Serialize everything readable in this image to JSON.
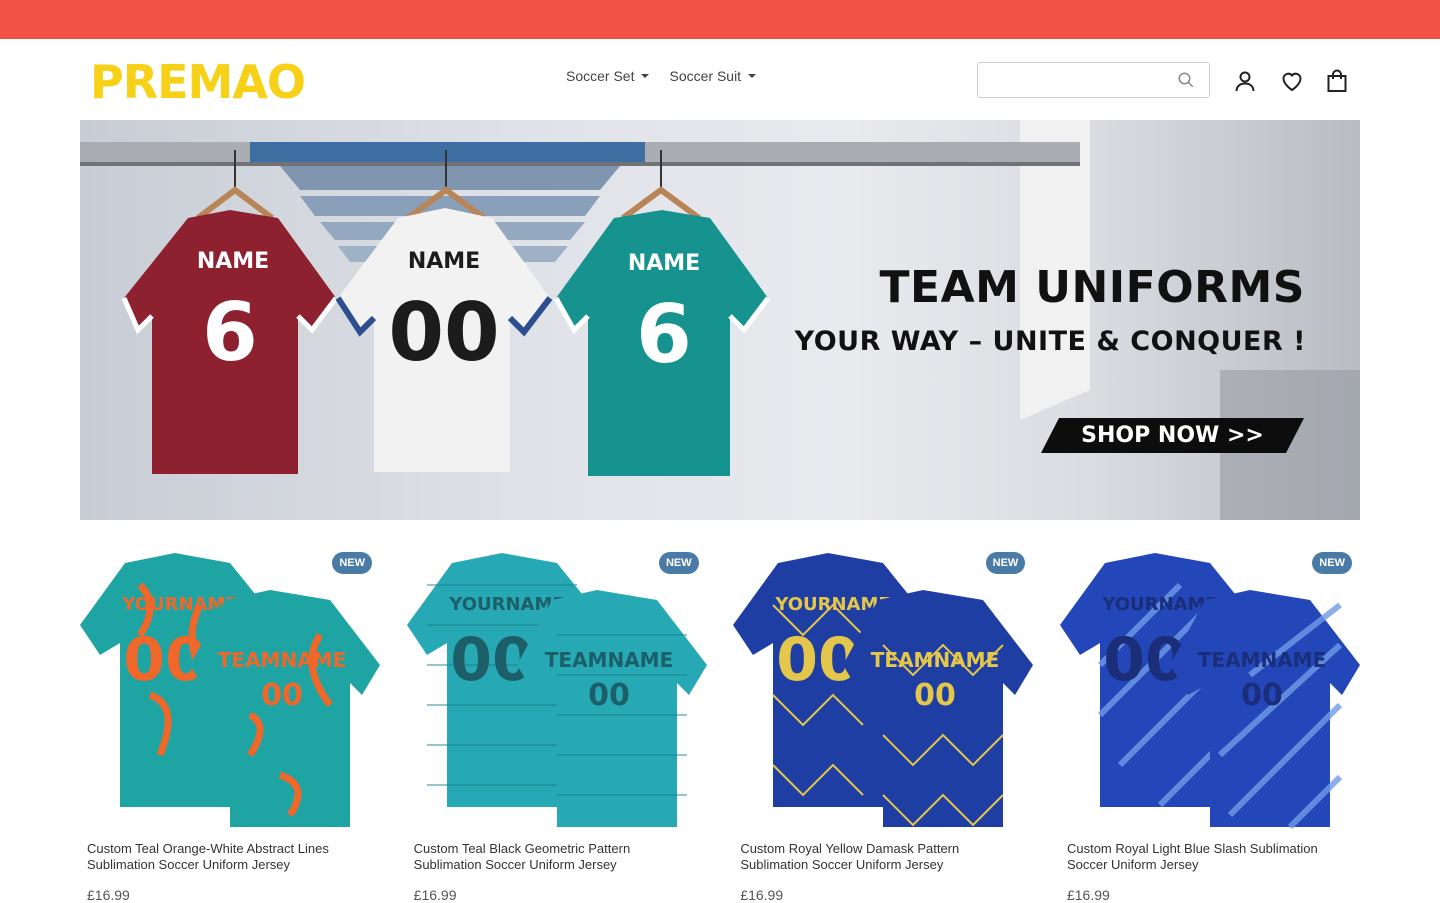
{
  "brand": {
    "logo_text": "PREMAO",
    "accent": "#f25244",
    "logo_color": "#f7d117"
  },
  "nav": {
    "items": [
      {
        "label": "Soccer Set"
      },
      {
        "label": "Soccer Suit"
      }
    ]
  },
  "search": {
    "value": "",
    "placeholder": ""
  },
  "header_icons": [
    "search-icon",
    "user-icon",
    "heart-icon",
    "bag-icon"
  ],
  "hero": {
    "title": "TEAM UNIFORMS",
    "subtitle": "YOUR WAY – UNITE & CONQUER !",
    "cta": "SHOP NOW >>",
    "jerseys": [
      {
        "name": "NAME",
        "number": "6",
        "color": "#8e2130"
      },
      {
        "name": "NAME",
        "number": "00",
        "color": "#f2f2f2"
      },
      {
        "name": "NAME",
        "number": "6",
        "color": "#16938f"
      }
    ]
  },
  "products": [
    {
      "badge": "NEW",
      "title": "Custom Teal Orange-White Abstract Lines Sublimation Soccer Uniform Jersey",
      "price": "£16.99",
      "front_text": "YOURNAME",
      "back_text": "TEAMNAME",
      "number": "00",
      "base": "#1ea5a3",
      "accent": "#f0672a"
    },
    {
      "badge": "NEW",
      "title": "Custom Teal Black Geometric Pattern Sublimation Soccer Uniform Jersey",
      "price": "£16.99",
      "front_text": "YOURNAME",
      "back_text": "TEAMNAME",
      "number": "00",
      "base": "#27a9b5",
      "accent": "#1d5f68"
    },
    {
      "badge": "NEW",
      "title": "Custom Royal Yellow Damask Pattern Sublimation Soccer Uniform Jersey",
      "price": "£16.99",
      "front_text": "YOURNAME",
      "back_text": "TEAMNAME",
      "number": "00",
      "base": "#1f3ea3",
      "accent": "#e3c64a"
    },
    {
      "badge": "NEW",
      "title": "Custom Royal Light Blue Slash Sublimation Soccer Uniform Jersey",
      "price": "£16.99",
      "front_text": "YOURNAME",
      "back_text": "TEAMNAME",
      "number": "00",
      "base": "#2346b8",
      "accent": "#6f9be6"
    }
  ]
}
